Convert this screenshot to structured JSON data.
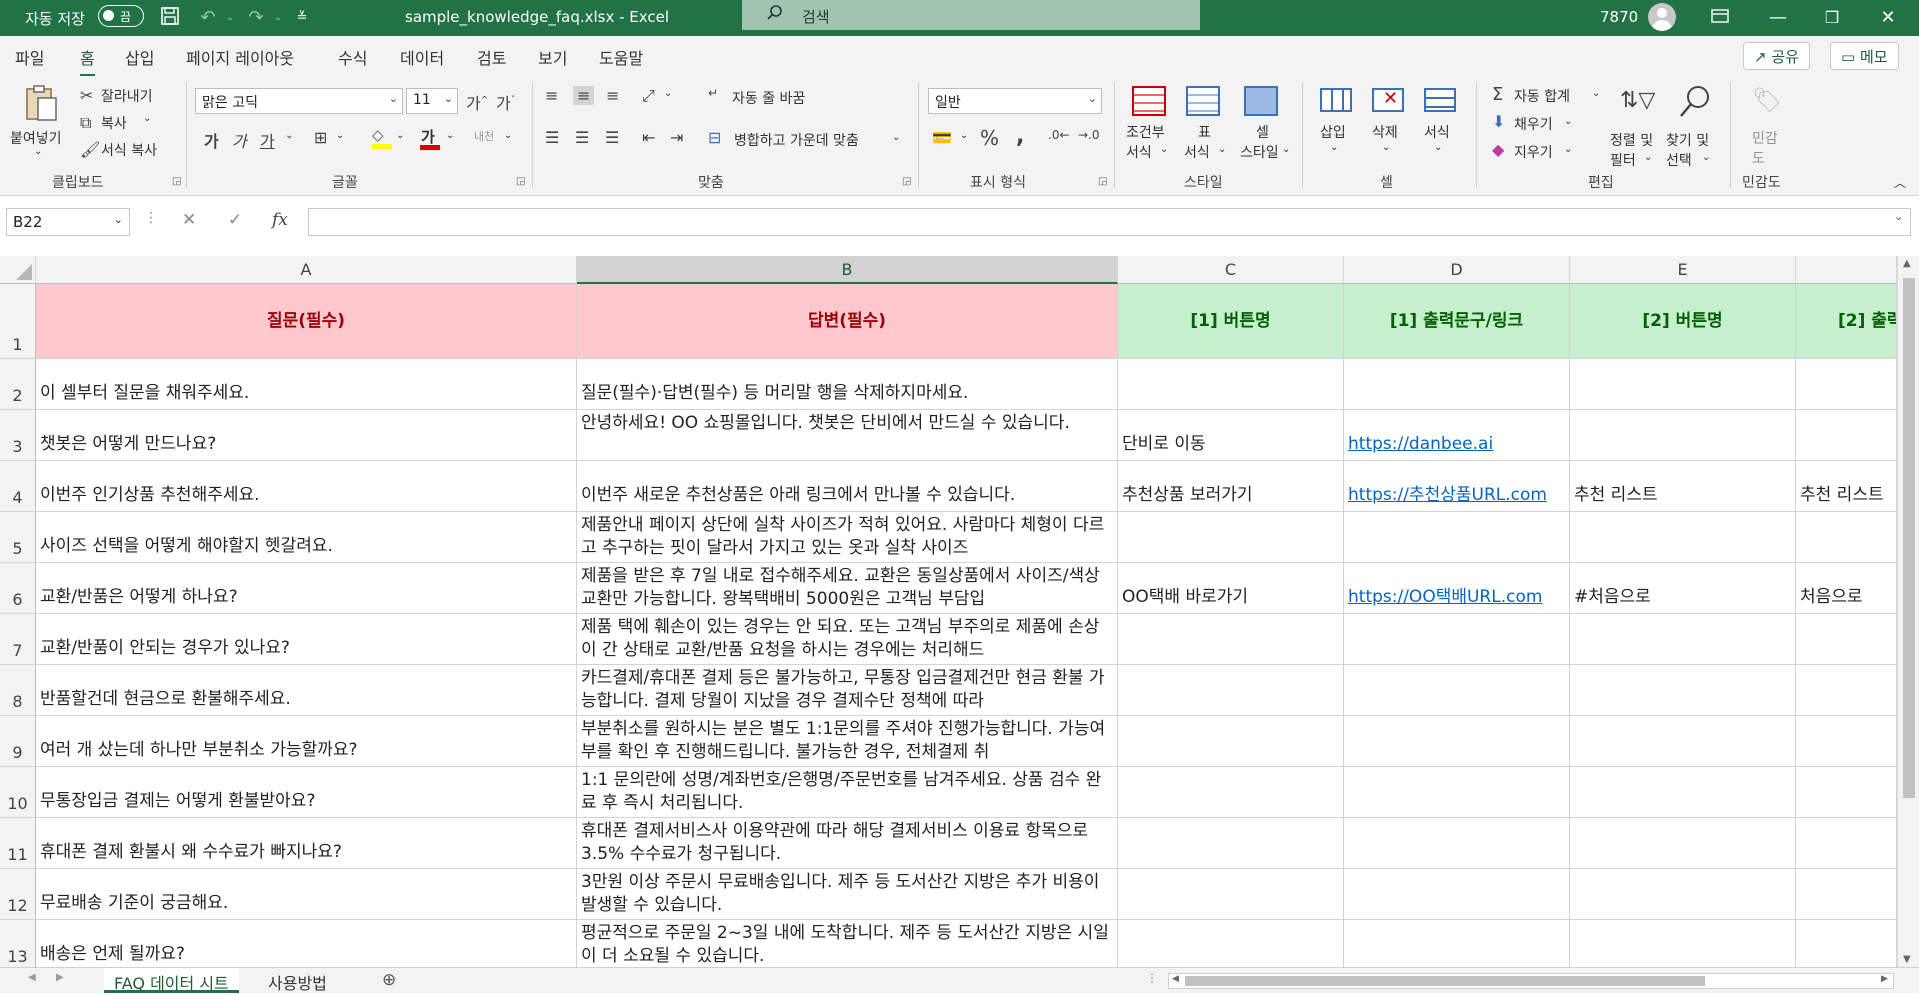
{
  "titlebar": {
    "autosave_label": "자동 저장",
    "autosave_state": "끔",
    "doc_title": "sample_knowledge_faq.xlsx  -  Excel",
    "search_placeholder": "검색",
    "user_number": "7870"
  },
  "ribbon_tabs": [
    "파일",
    "홈",
    "삽입",
    "페이지 레이아웃",
    "수식",
    "데이터",
    "검토",
    "보기",
    "도움말"
  ],
  "active_tab": "홈",
  "share_label": "공유",
  "memo_label": "메모",
  "clipboard": {
    "paste": "붙여넣기",
    "cut": "잘라내기",
    "copy": "복사",
    "format_painter": "서식 복사",
    "group": "클립보드"
  },
  "font": {
    "name": "맑은 고딕",
    "size": "11",
    "bold": "가",
    "italic": "가",
    "underline": "가",
    "font_color_glyph": "가",
    "group": "글꼴"
  },
  "alignment": {
    "wrap": "자동 줄 바꿈",
    "merge": "병합하고 가운데 맞춤",
    "group": "맞춤"
  },
  "number": {
    "format": "일반",
    "group": "표시 형식"
  },
  "styles": {
    "conditional_1": "조건부",
    "conditional_2": "서식",
    "table_1": "표",
    "table_2": "서식",
    "cell_1": "셀",
    "cell_2": "스타일",
    "group": "스타일"
  },
  "cells": {
    "insert": "삽입",
    "delete": "삭제",
    "format": "서식",
    "group": "셀"
  },
  "editing": {
    "autosum": "자동 합계",
    "fill": "채우기",
    "clear": "지우기",
    "sort_1": "정렬 및",
    "sort_2": "필터",
    "find_1": "찾기 및",
    "find_2": "선택",
    "group": "편집"
  },
  "sensitivity": {
    "label_1": "민감",
    "label_2": "도",
    "group": "민감도"
  },
  "namebox": "B22",
  "fx_label": "fx",
  "formula_value": "",
  "columns": [
    "A",
    "B",
    "C",
    "D",
    "E",
    ""
  ],
  "selected_column": "B",
  "header_row": [
    "질문(필수)",
    "답변(필수)",
    "[1] 버튼명",
    "[1] 출력문구/링크",
    "[2] 버튼명",
    "[2] 출력"
  ],
  "rows": [
    {
      "num": "2",
      "a": "이 셀부터 질문을 채워주세요.",
      "b": "질문(필수)·답변(필수) 등 머리말 행을 삭제하지마세요.",
      "c": "",
      "d": "",
      "e": "",
      "f": ""
    },
    {
      "num": "3",
      "a": "챗봇은 어떻게 만드나요?",
      "b": "안녕하세요! OO 쇼핑몰입니다. 챗봇은 단비에서 만드실 수 있습니다.",
      "c": "단비로 이동",
      "d": "https://danbee.ai",
      "e": "",
      "f": ""
    },
    {
      "num": "4",
      "a": "이번주 인기상품 추천해주세요.",
      "b": "이번주 새로운 추천상품은 아래 링크에서 만나볼 수 있습니다.",
      "c": "추천상품 보러가기",
      "d": "https://추천상품URL.com",
      "e": "추천 리스트",
      "f": "추천 리스트"
    },
    {
      "num": "5",
      "a": "사이즈 선택을 어떻게 해야할지 헷갈려요.",
      "b": "제품안내 페이지 상단에 실착 사이즈가 적혀 있어요. 사람마다 체형이 다르고 추구하는 핏이 달라서 가지고 있는 옷과 실착 사이즈",
      "c": "",
      "d": "",
      "e": "",
      "f": ""
    },
    {
      "num": "6",
      "a": "교환/반품은 어떻게 하나요?",
      "b": "제품을 받은 후 7일 내로 접수해주세요. 교환은 동일상품에서 사이즈/색상 교환만 가능합니다. 왕복택배비 5000원은 고객님 부담입",
      "c": "OO택배 바로가기",
      "d": "https://OO택배URL.com",
      "e": "#처음으로",
      "f": "처음으로"
    },
    {
      "num": "7",
      "a": "교환/반품이 안되는 경우가 있나요?",
      "b": "제품 택에 훼손이 있는 경우는 안 되요. 또는 고객님 부주의로 제품에 손상이 간 상태로 교환/반품 요청을 하시는 경우에는 처리해드",
      "c": "",
      "d": "",
      "e": "",
      "f": ""
    },
    {
      "num": "8",
      "a": "반품할건데 현금으로 환불해주세요.",
      "b": "카드결제/휴대폰 결제 등은 불가능하고, 무통장 입금결제건만 현금 환불 가능합니다. 결제 당월이 지났을 경우 결제수단 정책에 따라",
      "c": "",
      "d": "",
      "e": "",
      "f": ""
    },
    {
      "num": "9",
      "a": "여러 개 샀는데 하나만 부분취소 가능할까요?",
      "b": "부분취소를 원하시는 분은 별도 1:1문의를 주셔야 진행가능합니다. 가능여부를 확인 후 진행해드립니다. 불가능한 경우, 전체결제 취",
      "c": "",
      "d": "",
      "e": "",
      "f": ""
    },
    {
      "num": "10",
      "a": "무통장입금 결제는 어떻게 환불받아요?",
      "b": "1:1 문의란에 성명/계좌번호/은행명/주문번호를 남겨주세요. 상품 검수 완료 후 즉시 처리됩니다.",
      "c": "",
      "d": "",
      "e": "",
      "f": ""
    },
    {
      "num": "11",
      "a": "휴대폰 결제 환불시 왜 수수료가 빠지나요?",
      "b": "휴대폰 결제서비스사 이용약관에 따라 해당 결제서비스 이용료 항목으로 3.5% 수수료가 청구됩니다.",
      "c": "",
      "d": "",
      "e": "",
      "f": ""
    },
    {
      "num": "12",
      "a": "무료배송 기준이 궁금해요.",
      "b": "3만원 이상 주문시 무료배송입니다. 제주 등 도서산간 지방은 추가 비용이 발생할 수 있습니다.",
      "c": "",
      "d": "",
      "e": "",
      "f": ""
    },
    {
      "num": "13",
      "a": "배송은 언제 될까요?",
      "b": "평균적으로 주문일 2~3일 내에 도착합니다. 제주 등 도서산간 지방은 시일이 더 소요될 수 있습니다.",
      "c": "",
      "d": "",
      "e": "",
      "f": ""
    }
  ],
  "header_row_num": "1",
  "sheet_tabs": [
    "FAQ 데이터 시트",
    "사용방법"
  ],
  "active_sheet": "FAQ 데이터 시트",
  "colors": {
    "accent": "#217346",
    "header_pink": "#ffc7ce",
    "header_pink_text": "#9c0006",
    "header_green": "#c6efce",
    "header_green_text": "#006100",
    "link": "#0563c1"
  }
}
